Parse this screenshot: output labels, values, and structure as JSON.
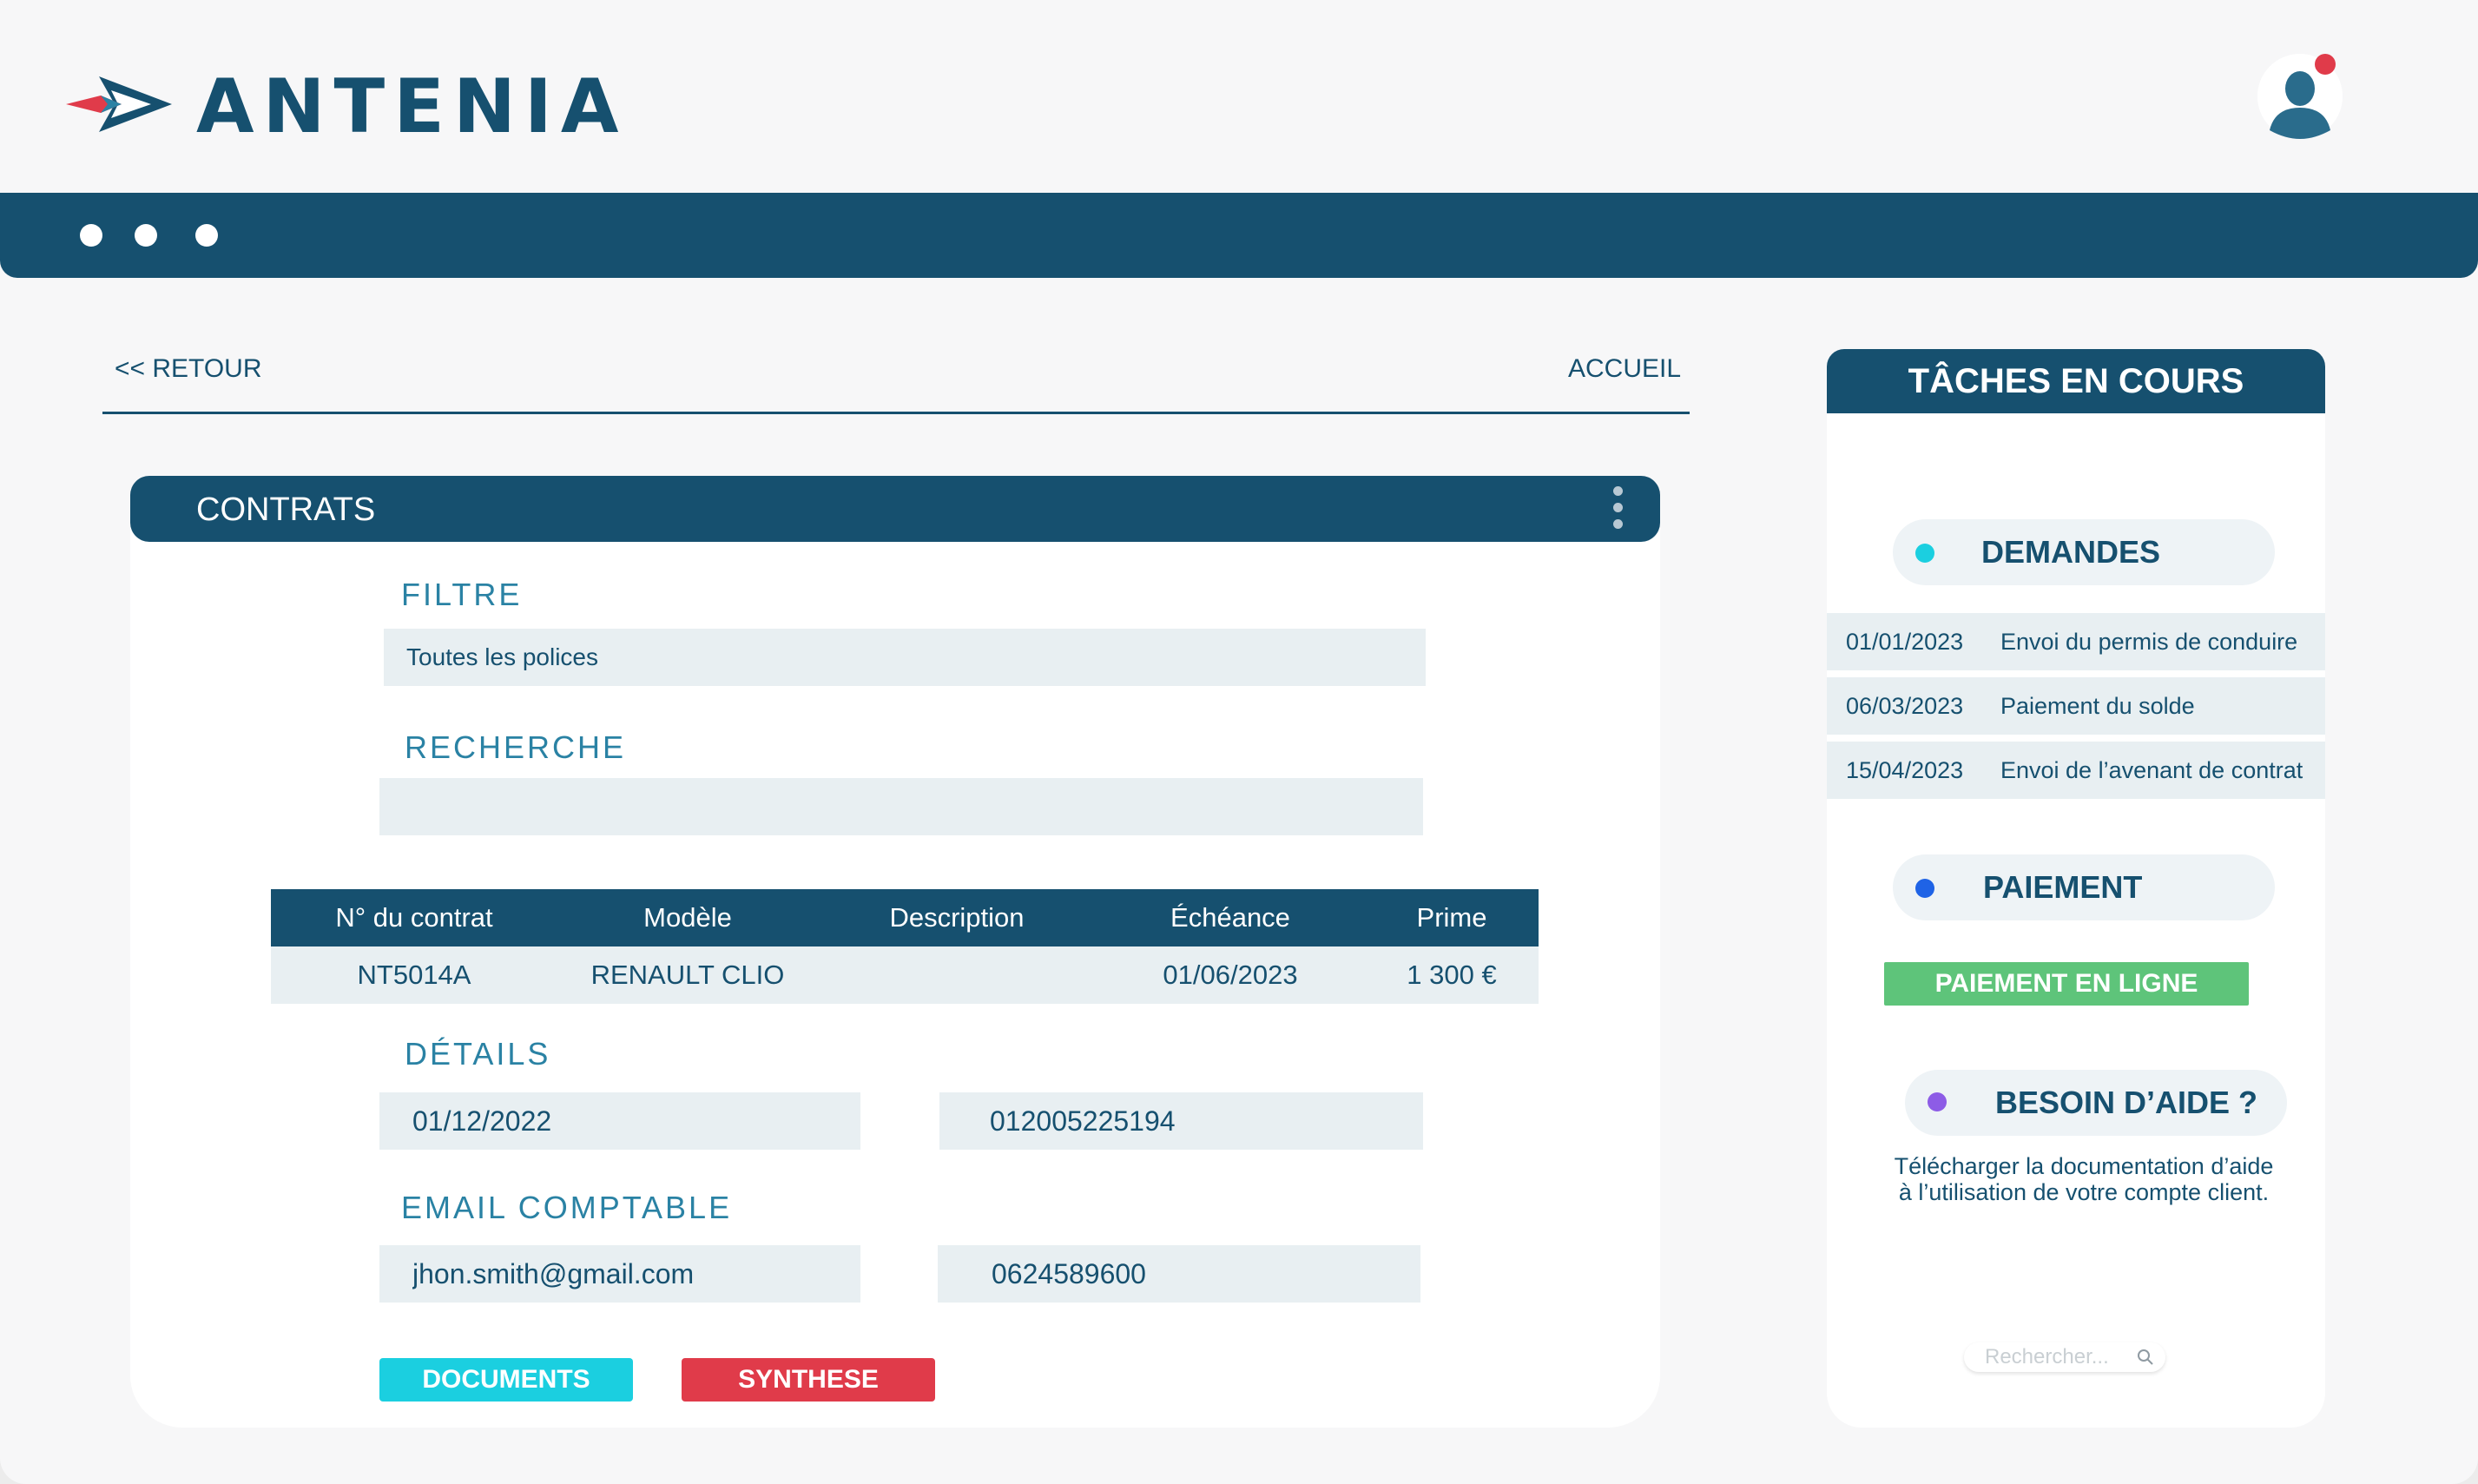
{
  "header": {
    "brand": "ANTENIA",
    "logo_icon": "paper-plane-arrow-icon",
    "avatar_icon": "user-icon",
    "notification": "red-dot"
  },
  "nav": {
    "back": "<< RETOUR",
    "home": "ACCUEIL"
  },
  "contracts": {
    "title": "CONTRATS",
    "filter_label": "FILTRE",
    "filter_value": "Toutes les polices",
    "search_label": "RECHERCHE",
    "search_value": "",
    "table": {
      "headers": [
        "N° du contrat",
        "Modèle",
        "Description",
        "Échéance",
        "Prime"
      ],
      "rows": [
        [
          "NT5014A",
          "RENAULT CLIO",
          "",
          "01/06/2023",
          "1 300 €"
        ]
      ]
    },
    "details_label": "DÉTAILS",
    "details_date": "01/12/2022",
    "details_number": "012005225194",
    "email_label": "EMAIL COMPTABLE",
    "email_value": "jhon.smith@gmail.com",
    "phone_value": "0624589600",
    "btn_documents": "DOCUMENTS",
    "btn_synthese": "SYNTHESE"
  },
  "tasks": {
    "title": "TÂCHES EN COURS",
    "demandes_label": "DEMANDES",
    "demandes": [
      {
        "date": "01/01/2023",
        "text": "Envoi du permis de conduire"
      },
      {
        "date": "06/03/2023",
        "text": "Paiement du solde"
      },
      {
        "date": "15/04/2023",
        "text": "Envoi de l’avenant de contrat"
      }
    ],
    "paiement_label": "PAIEMENT",
    "paiement_button": "PAIEMENT EN LIGNE",
    "aide_label": "BESOIN D’AIDE ?",
    "aide_text_line1": "Télécharger la documentation d’aide",
    "aide_text_line2": "à l’utilisation de votre compte client.",
    "search_placeholder": "Rechercher..."
  },
  "colors": {
    "primary": "#16506f",
    "accent_teal": "#2a82a4",
    "cyan": "#1bcfe0",
    "red": "#e03b4a",
    "green": "#5ec47a",
    "blue_dot": "#1f63e6",
    "purple_dot": "#8d5ce6",
    "field_bg": "#e8eff2"
  }
}
